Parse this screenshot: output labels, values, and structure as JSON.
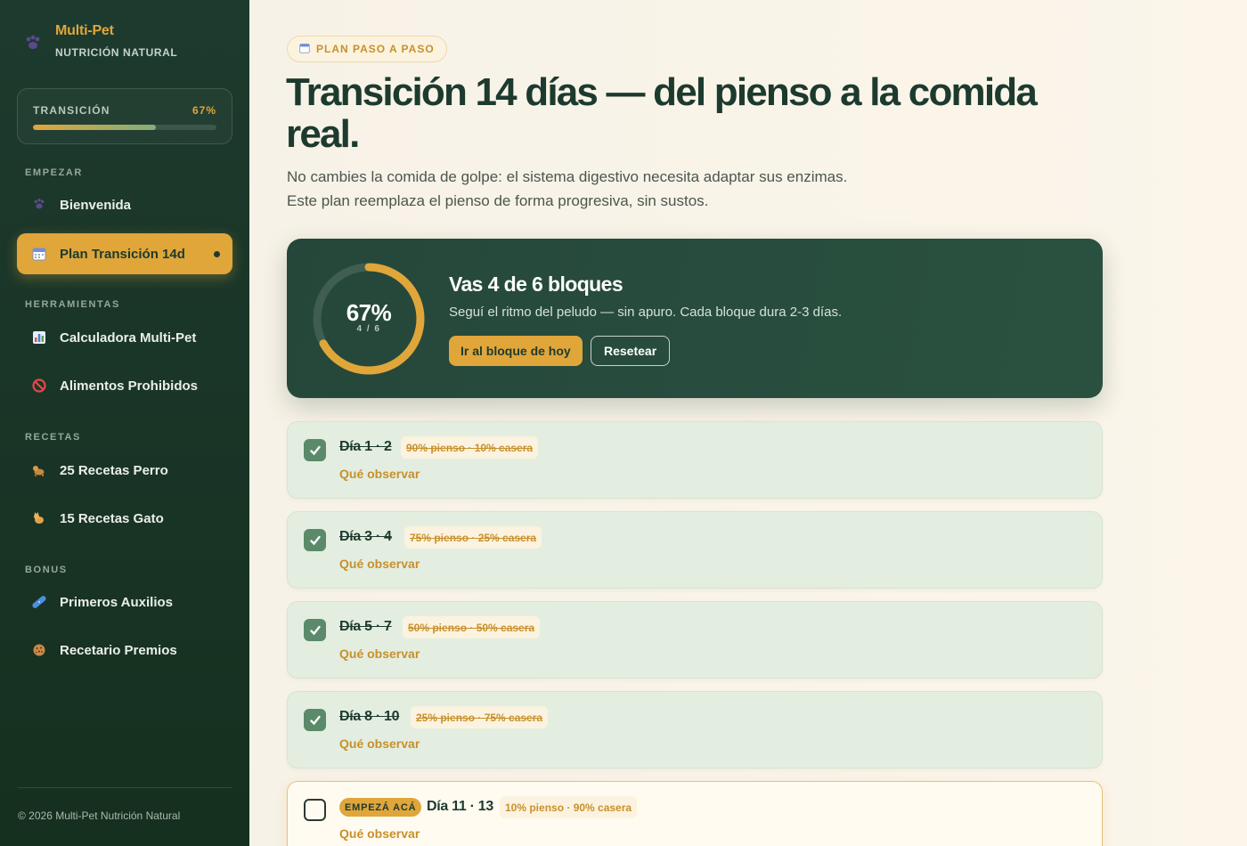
{
  "brand": {
    "title": "Multi-Pet",
    "subtitle": "NUTRICIÓN NATURAL"
  },
  "sidebar_progress": {
    "label": "TRANSICIÓN",
    "percent_text": "67%",
    "fraction": 0.67
  },
  "sections": {
    "start": "EMPEZAR",
    "tools": "HERRAMIENTAS",
    "recipes": "RECETAS",
    "bonus": "BONUS"
  },
  "nav": [
    {
      "label": "Bienvenida",
      "icon": "paw-icon"
    },
    {
      "label": "Plan Transición 14d",
      "icon": "calendar-icon",
      "active": true
    },
    {
      "label": "Calculadora Multi-Pet",
      "icon": "bar-chart-icon"
    },
    {
      "label": "Alimentos Prohibidos",
      "icon": "prohibited-icon"
    },
    {
      "label": "25 Recetas Perro",
      "icon": "dog-icon"
    },
    {
      "label": "15 Recetas Gato",
      "icon": "cat-icon"
    },
    {
      "label": "Primeros Auxilios",
      "icon": "bandage-icon"
    },
    {
      "label": "Recetario Premios",
      "icon": "cookie-icon"
    }
  ],
  "footer": "© 2026 Multi-Pet Nutrición Natural",
  "page": {
    "pill": "PLAN PASO A PASO",
    "title": "Transición 14 días — del pienso a la comida real.",
    "lead": "No cambies la comida de golpe: el sistema digestivo necesita adaptar sus enzimas. Este plan reemplaza el pienso de forma progresiva, sin sustos."
  },
  "hero": {
    "ring_percent": "67%",
    "ring_sub": "4 / 6",
    "progress_fraction": 0.67,
    "title": "Vas 4 de 6 bloques",
    "subtitle": "Seguí el ritmo del peludo — sin apuro. Cada bloque dura 2-3 días.",
    "primary_btn": "Ir al bloque de hoy",
    "ghost_btn": "Resetear"
  },
  "steps": [
    {
      "day": "Día 1 · 2",
      "mix": "90% pienso · 10% casera",
      "observe": "Qué observar",
      "done": true
    },
    {
      "day": "Día 3 · 4",
      "mix": "75% pienso · 25% casera",
      "observe": "Qué observar",
      "done": true
    },
    {
      "day": "Día 5 · 7",
      "mix": "50% pienso · 50% casera",
      "observe": "Qué observar",
      "done": true
    },
    {
      "day": "Día 8 · 10",
      "mix": "25% pienso · 75% casera",
      "observe": "Qué observar",
      "done": true
    },
    {
      "day": "Día 11 · 13",
      "mix": "10% pienso · 90% casera",
      "observe": "Qué observar",
      "done": false,
      "badge": "EMPEZÁ ACÁ"
    }
  ],
  "colors": {
    "sidebar": "#1d3a2e",
    "accent": "#e0a63a",
    "done_card": "#e3eee0",
    "check": "#5a8a69"
  }
}
